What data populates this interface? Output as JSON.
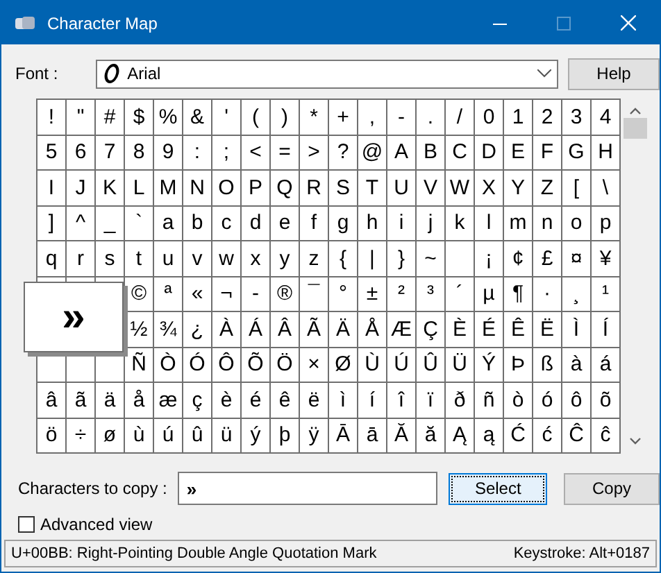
{
  "window": {
    "title": "Character Map",
    "maximize_disabled": true
  },
  "font": {
    "label": "Font :",
    "value": "Arial"
  },
  "help_button": "Help",
  "grid": {
    "rows": [
      [
        "!",
        "\"",
        "#",
        "$",
        "%",
        "&",
        "'",
        "(",
        ")",
        "*",
        "+",
        ",",
        "-",
        ".",
        "/",
        "0",
        "1",
        "2",
        "3",
        "4"
      ],
      [
        "5",
        "6",
        "7",
        "8",
        "9",
        ":",
        ";",
        "<",
        "=",
        ">",
        "?",
        "@",
        "A",
        "B",
        "C",
        "D",
        "E",
        "F",
        "G",
        "H"
      ],
      [
        "I",
        "J",
        "K",
        "L",
        "M",
        "N",
        "O",
        "P",
        "Q",
        "R",
        "S",
        "T",
        "U",
        "V",
        "W",
        "X",
        "Y",
        "Z",
        "[",
        "\\"
      ],
      [
        "]",
        "^",
        "_",
        "`",
        "a",
        "b",
        "c",
        "d",
        "e",
        "f",
        "g",
        "h",
        "i",
        "j",
        "k",
        "l",
        "m",
        "n",
        "o",
        "p"
      ],
      [
        "q",
        "r",
        "s",
        "t",
        "u",
        "v",
        "w",
        "x",
        "y",
        "z",
        "{",
        "|",
        "}",
        "~",
        null,
        "¡",
        "¢",
        "£",
        "¤",
        "¥"
      ],
      [
        null,
        null,
        null,
        "©",
        "ª",
        "«",
        "¬",
        "-",
        "®",
        "¯",
        "°",
        "±",
        "²",
        "³",
        "´",
        "µ",
        "¶",
        "·",
        "¸",
        "¹"
      ],
      [
        null,
        null,
        null,
        "½",
        "¾",
        "¿",
        "À",
        "Á",
        "Â",
        "Ã",
        "Ä",
        "Å",
        "Æ",
        "Ç",
        "È",
        "É",
        "Ê",
        "Ë",
        "Ì",
        "Í"
      ],
      [
        null,
        null,
        null,
        "Ñ",
        "Ò",
        "Ó",
        "Ô",
        "Õ",
        "Ö",
        "×",
        "Ø",
        "Ù",
        "Ú",
        "Û",
        "Ü",
        "Ý",
        "Þ",
        "ß",
        "à",
        "á"
      ],
      [
        "â",
        "ã",
        "ä",
        "å",
        "æ",
        "ç",
        "è",
        "é",
        "ê",
        "ë",
        "ì",
        "í",
        "î",
        "ï",
        "ð",
        "ñ",
        "ò",
        "ó",
        "ô",
        "õ"
      ],
      [
        "ö",
        "÷",
        "ø",
        "ù",
        "ú",
        "û",
        "ü",
        "ý",
        "þ",
        "ÿ",
        "Ā",
        "ā",
        "Ă",
        "ă",
        "Ą",
        "ą",
        "Ć",
        "ć",
        "Ĉ",
        "ĉ"
      ]
    ],
    "magnified": "»"
  },
  "copy": {
    "label": "Characters to copy :",
    "value": "»",
    "select_button": "Select",
    "copy_button": "Copy"
  },
  "advanced_view": {
    "label": "Advanced view",
    "checked": false
  },
  "status_bar": {
    "description": "U+00BB: Right-Pointing Double Angle Quotation Mark",
    "keystroke": "Keystroke: Alt+0187"
  }
}
